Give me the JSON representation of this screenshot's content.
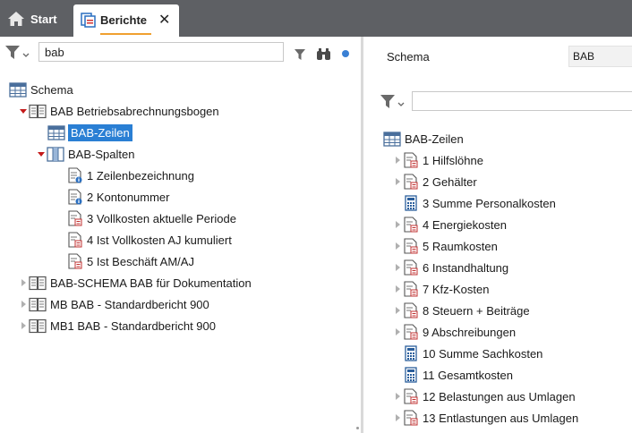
{
  "tabs": {
    "start_label": "Start",
    "active_label": "Berichte",
    "close_glyph": "✕"
  },
  "left": {
    "search_value": "bab",
    "tree": [
      {
        "label": "Schema",
        "icon": "table-icon"
      },
      {
        "label": "BAB  Betriebsabrechnungsbogen",
        "icon": "book-icon"
      },
      {
        "label": "BAB-Zeilen",
        "icon": "table-icon",
        "selected": true
      },
      {
        "label": "BAB-Spalten",
        "icon": "columns-icon"
      },
      {
        "label": "1  Zeilenbezeichnung",
        "icon": "doc-info-icon"
      },
      {
        "label": "2  Kontonummer",
        "icon": "doc-info-icon"
      },
      {
        "label": "3  Vollkosten aktuelle Periode",
        "icon": "doc-calc-icon"
      },
      {
        "label": "4   Ist Vollkosten AJ kumuliert",
        "icon": "doc-calc-icon"
      },
      {
        "label": "5  Ist Beschäft AM/AJ",
        "icon": "doc-calc-icon"
      },
      {
        "label": "BAB-SCHEMA  BAB für Dokumentation",
        "icon": "book-icon"
      },
      {
        "label": "MB  BAB - Standardbericht 900",
        "icon": "book-icon"
      },
      {
        "label": "MB1  BAB - Standardbericht 900",
        "icon": "book-icon"
      }
    ]
  },
  "right": {
    "schema_label": "Schema",
    "schema_value": "BAB",
    "root_label": "BAB-Zeilen",
    "rows": [
      {
        "label": "1  Hilfslöhne",
        "icon": "doc-calc-icon",
        "expandable": true
      },
      {
        "label": "2  Gehälter",
        "icon": "doc-calc-icon",
        "expandable": true
      },
      {
        "label": "3  Summe Personalkosten",
        "icon": "calculator-icon",
        "expandable": false
      },
      {
        "label": "4  Energiekosten",
        "icon": "doc-calc-icon",
        "expandable": true
      },
      {
        "label": "5  Raumkosten",
        "icon": "doc-calc-icon",
        "expandable": true
      },
      {
        "label": "6  Instandhaltung",
        "icon": "doc-calc-icon",
        "expandable": true
      },
      {
        "label": "7  Kfz-Kosten",
        "icon": "doc-calc-icon",
        "expandable": true
      },
      {
        "label": "8  Steuern + Beiträge",
        "icon": "doc-calc-icon",
        "expandable": true
      },
      {
        "label": "9  Abschreibungen",
        "icon": "doc-calc-icon",
        "expandable": true
      },
      {
        "label": "10  Summe Sachkosten",
        "icon": "calculator-icon",
        "expandable": false
      },
      {
        "label": "11  Gesamtkosten",
        "icon": "calculator-icon",
        "expandable": false
      },
      {
        "label": "12  Belastungen aus Umlagen",
        "icon": "doc-calc-icon",
        "expandable": true
      },
      {
        "label": "13  Entlastungen aus Umlagen",
        "icon": "doc-calc-icon",
        "expandable": true
      }
    ]
  },
  "colors": {
    "tabbar": "#5e6064",
    "accent": "#f0a030",
    "selection": "#2a7fd4",
    "expand_arrow": "#c41a1a"
  }
}
